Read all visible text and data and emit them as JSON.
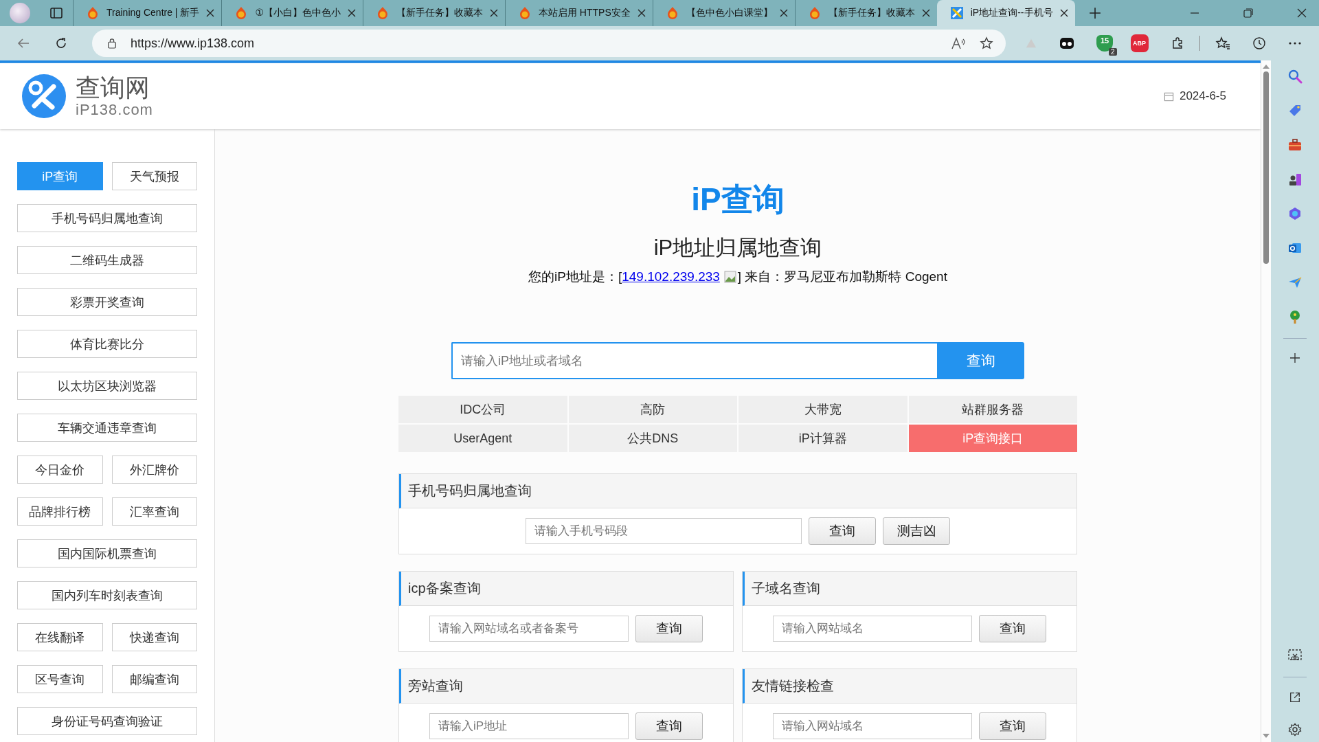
{
  "browser": {
    "tabs": [
      {
        "title": "Training Centre | 新手",
        "kind": "fire",
        "selected": false
      },
      {
        "title": "①【小白】色中色小",
        "kind": "fire",
        "selected": false
      },
      {
        "title": "【新手任务】收藏本",
        "kind": "fire",
        "selected": false
      },
      {
        "title": "本站启用 HTTPS安全",
        "kind": "fire",
        "selected": false
      },
      {
        "title": "【色中色小白课堂】",
        "kind": "fire",
        "selected": false
      },
      {
        "title": "【新手任务】收藏本",
        "kind": "fire",
        "selected": false
      },
      {
        "title": "iP地址查询--手机号",
        "kind": "tools",
        "selected": true
      }
    ],
    "address": "https://www.ip138.com",
    "extensions": [
      {
        "kind": "triangle"
      },
      {
        "kind": "ghost"
      },
      {
        "kind": "shield",
        "label": "15",
        "badge": "2"
      },
      {
        "kind": "abp",
        "label": "ABP"
      },
      {
        "kind": "puzzle"
      }
    ]
  },
  "header": {
    "logo_title": "查询网",
    "logo_domain": "iP138.com",
    "date": "2024-6-5"
  },
  "sidebar": {
    "rows": [
      {
        "items": [
          {
            "label": "iP查询",
            "selected": true
          },
          {
            "label": "天气预报",
            "selected": false
          }
        ]
      },
      {
        "items": [
          {
            "label": "手机号码归属地查询",
            "selected": false
          }
        ]
      },
      {
        "items": [
          {
            "label": "二维码生成器",
            "selected": false
          }
        ]
      },
      {
        "items": [
          {
            "label": "彩票开奖查询",
            "selected": false
          }
        ]
      },
      {
        "items": [
          {
            "label": "体育比赛比分",
            "selected": false
          }
        ]
      },
      {
        "items": [
          {
            "label": "以太坊区块浏览器",
            "selected": false
          }
        ]
      },
      {
        "items": [
          {
            "label": "车辆交通违章查询",
            "selected": false
          }
        ]
      },
      {
        "items": [
          {
            "label": "今日金价",
            "selected": false
          },
          {
            "label": "外汇牌价",
            "selected": false
          }
        ]
      },
      {
        "items": [
          {
            "label": "品牌排行榜",
            "selected": false
          },
          {
            "label": "汇率查询",
            "selected": false
          }
        ]
      },
      {
        "items": [
          {
            "label": "国内国际机票查询",
            "selected": false
          }
        ]
      },
      {
        "items": [
          {
            "label": "国内列车时刻表查询",
            "selected": false
          }
        ]
      },
      {
        "items": [
          {
            "label": "在线翻译",
            "selected": false
          },
          {
            "label": "快递查询",
            "selected": false
          }
        ]
      },
      {
        "items": [
          {
            "label": "区号查询",
            "selected": false
          },
          {
            "label": "邮编查询",
            "selected": false
          }
        ]
      },
      {
        "items": [
          {
            "label": "身份证号码查询验证",
            "selected": false
          }
        ]
      }
    ]
  },
  "main": {
    "title": "iP查询",
    "subtitle": "iP地址归属地查询",
    "ip_line": {
      "prefix": "您的iP地址是：[",
      "ip": "149.102.239.233",
      "suffix": "] 来自：罗马尼亚布加勒斯特 Cogent"
    },
    "search": {
      "placeholder": "请输入iP地址或者域名",
      "button": "查询"
    },
    "quick_links": [
      {
        "label": "IDC公司",
        "highlighted": false
      },
      {
        "label": "高防",
        "highlighted": false
      },
      {
        "label": "大带宽",
        "highlighted": false
      },
      {
        "label": "站群服务器",
        "highlighted": false
      },
      {
        "label": "UserAgent",
        "highlighted": false
      },
      {
        "label": "公共DNS",
        "highlighted": false
      },
      {
        "label": "iP计算器",
        "highlighted": false
      },
      {
        "label": "iP查询接口",
        "highlighted": true
      }
    ],
    "cards": [
      {
        "title": "手机号码归属地查询",
        "wide": true,
        "placeholder": "请输入手机号码段",
        "buttons": [
          "查询",
          "测吉凶"
        ]
      },
      {
        "title": "icp备案查询",
        "wide": false,
        "placeholder": "请输入网站域名或者备案号",
        "buttons": [
          "查询"
        ]
      },
      {
        "title": "子域名查询",
        "wide": false,
        "placeholder": "请输入网站域名",
        "buttons": [
          "查询"
        ]
      },
      {
        "title": "旁站查询",
        "wide": false,
        "placeholder": "请输入iP地址",
        "buttons": [
          "查询"
        ]
      },
      {
        "title": "友情链接检查",
        "wide": false,
        "placeholder": "请输入网站域名",
        "buttons": [
          "查询"
        ]
      }
    ]
  }
}
